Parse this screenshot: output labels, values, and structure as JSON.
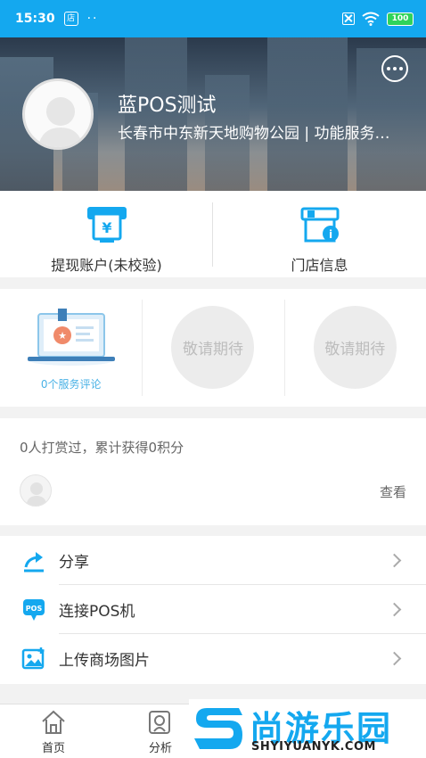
{
  "status_bar": {
    "time": "15:30",
    "app_badge": "店",
    "dots": "··",
    "battery": "100"
  },
  "profile": {
    "name": "蓝POS测试",
    "subtitle": "长春市中东新天地购物公园 | 功能服务中心"
  },
  "quick_actions": [
    {
      "label": "提现账户(未校验)",
      "icon": "withdraw-atm-icon"
    },
    {
      "label": "门店信息",
      "icon": "store-info-icon"
    }
  ],
  "badges": {
    "service_review_caption": "0个服务评论",
    "placeholders": [
      "敬请期待",
      "敬请期待"
    ]
  },
  "reward": {
    "summary": "0人打赏过，累计获得0积分",
    "view_label": "查看"
  },
  "menu": [
    {
      "label": "分享",
      "icon": "share-icon"
    },
    {
      "label": "连接POS机",
      "icon": "pos-icon"
    },
    {
      "label": "上传商场图片",
      "icon": "image-upload-icon"
    }
  ],
  "tabs": [
    {
      "label": "首页",
      "icon": "home-icon"
    },
    {
      "label": "分析",
      "icon": "analysis-icon"
    }
  ],
  "watermark": {
    "title": "尚游乐园",
    "url": "SHYIYUANYK.COM"
  },
  "colors": {
    "accent": "#14a8ef",
    "caption_blue": "#4ab2e6",
    "battery_green": "#2fd35a"
  }
}
